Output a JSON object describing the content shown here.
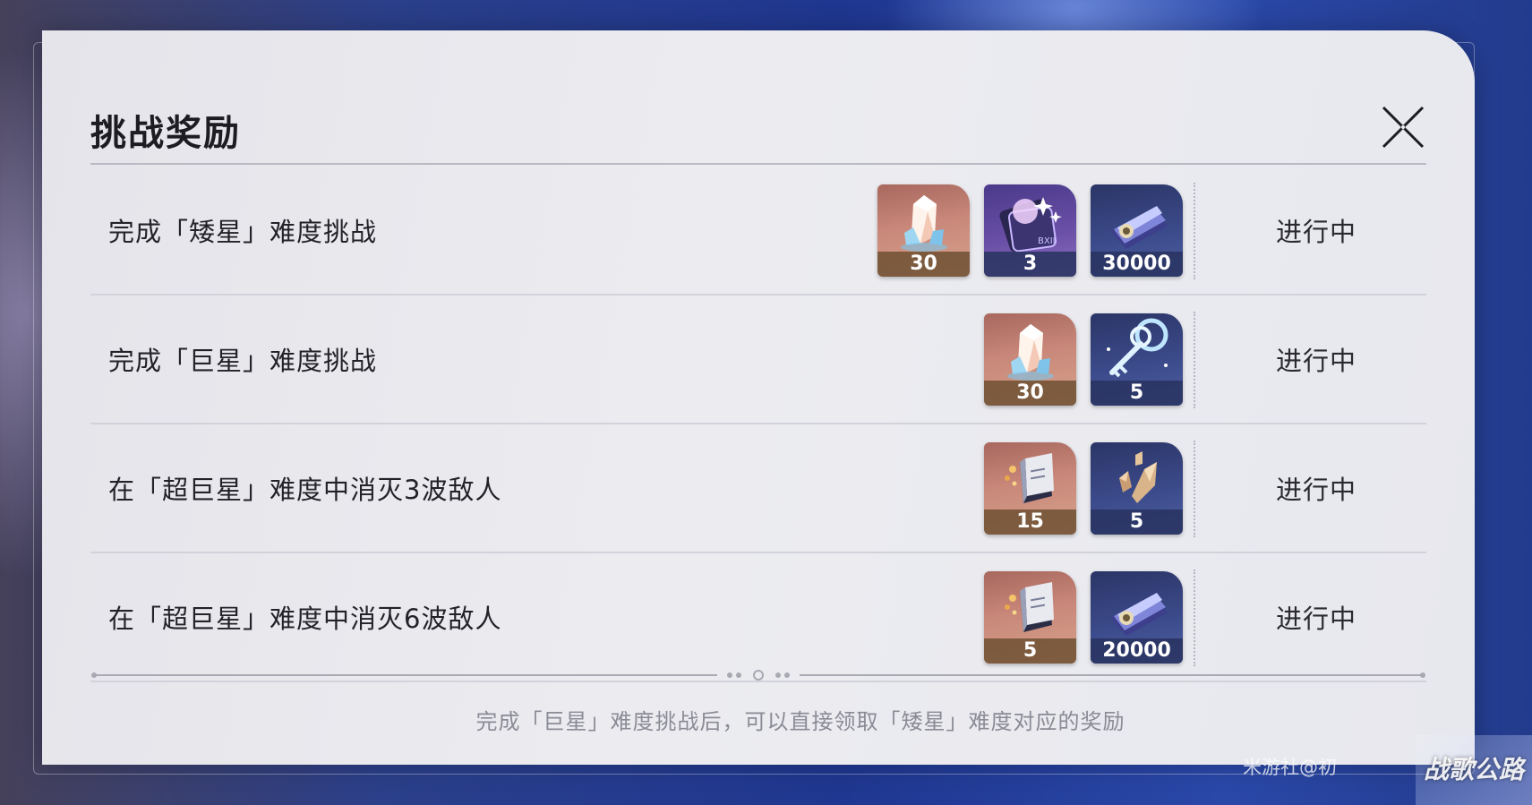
{
  "dialog": {
    "title": "挑战奖励",
    "note": "完成「巨星」难度挑战后，可以直接领取「矮星」难度对应的奖励"
  },
  "rows": [
    {
      "label": "完成「矮星」难度挑战",
      "status": "进行中",
      "rewards": [
        {
          "icon": "crystal-icon",
          "quantity": "30",
          "bg": "orange"
        },
        {
          "icon": "starlight-pass-icon",
          "quantity": "3",
          "bg": "purple"
        },
        {
          "icon": "credit-card-icon",
          "quantity": "30000",
          "bg": "blue"
        }
      ]
    },
    {
      "label": "完成「巨星」难度挑战",
      "status": "进行中",
      "rewards": [
        {
          "icon": "crystal-icon",
          "quantity": "30",
          "bg": "orange"
        },
        {
          "icon": "key-icon",
          "quantity": "5",
          "bg": "blue"
        }
      ]
    },
    {
      "label": "在「超巨星」难度中消灭3波敌人",
      "status": "进行中",
      "rewards": [
        {
          "icon": "manual-book-icon",
          "quantity": "15",
          "bg": "orange"
        },
        {
          "icon": "crystal-shards-icon",
          "quantity": "5",
          "bg": "blue"
        }
      ]
    },
    {
      "label": "在「超巨星」难度中消灭6波敌人",
      "status": "进行中",
      "rewards": [
        {
          "icon": "manual-book-icon",
          "quantity": "5",
          "bg": "orange"
        },
        {
          "icon": "credit-card-icon",
          "quantity": "20000",
          "bg": "blue"
        }
      ]
    }
  ],
  "watermark": "米游社@初",
  "corner_badge": "战歌公路",
  "colors": {
    "panel": "#e9e9ee",
    "title_text": "#1c1c22",
    "note_text": "#8a8b95",
    "reward_orange": "#c9887a",
    "reward_blue": "#3b4a8a",
    "reward_purple": "#6a4fa6"
  }
}
